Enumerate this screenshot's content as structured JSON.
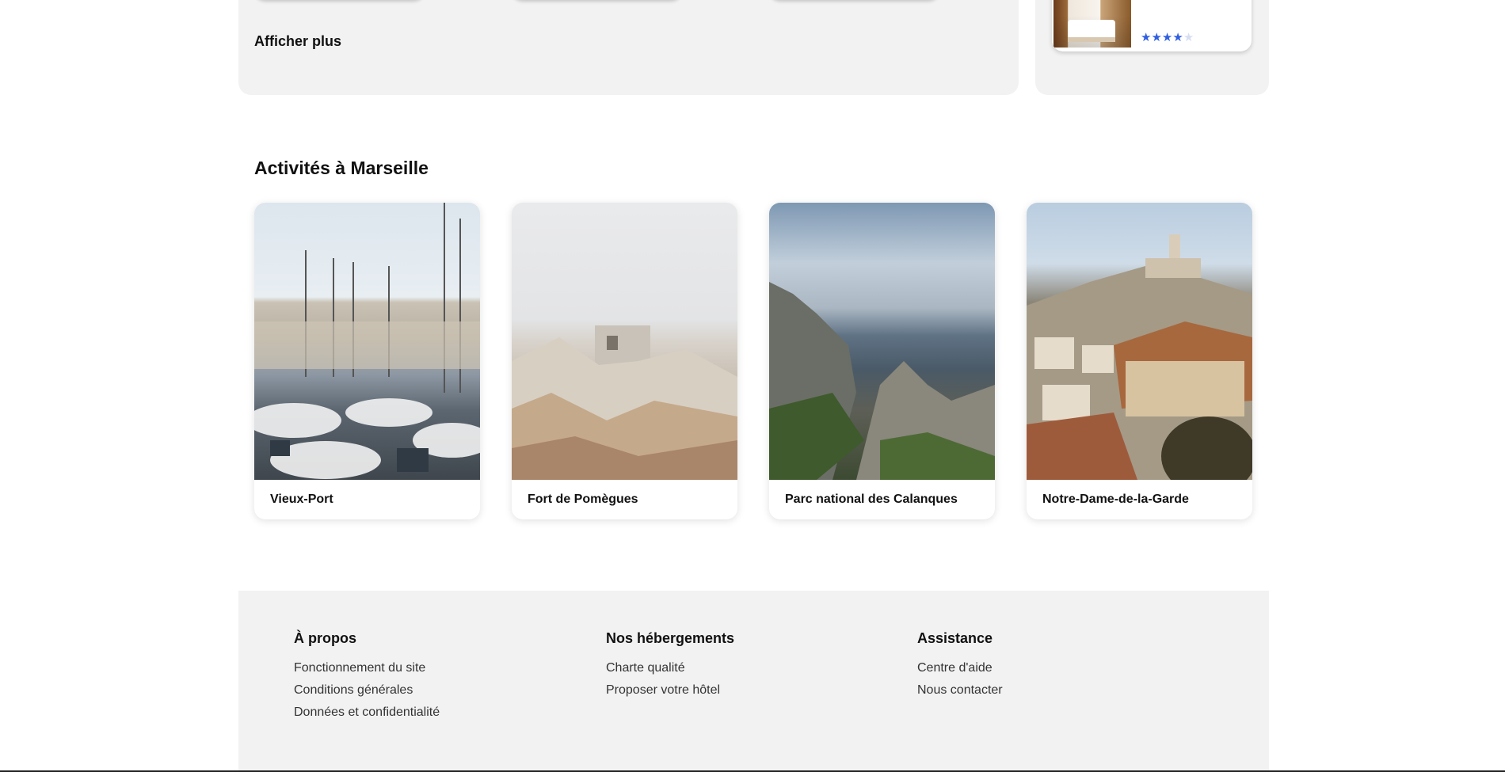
{
  "top_section": {
    "show_more_label": "Afficher plus",
    "hotel_card": {
      "stars_filled": 4,
      "stars_total": 5,
      "star_color": "#2f5ee0"
    }
  },
  "activities": {
    "title": "Activités à Marseille",
    "items": [
      {
        "label": "Vieux-Port"
      },
      {
        "label": "Fort de Pomègues"
      },
      {
        "label": "Parc national des Calanques"
      },
      {
        "label": "Notre-Dame-de-la-Garde"
      }
    ]
  },
  "footer": {
    "columns": [
      {
        "heading": "À propos",
        "links": [
          "Fonctionnement du site",
          "Conditions générales",
          "Données et confidentialité"
        ]
      },
      {
        "heading": "Nos hébergements",
        "links": [
          "Charte qualité",
          "Proposer votre hôtel"
        ]
      },
      {
        "heading": "Assistance",
        "links": [
          "Centre d'aide",
          "Nous contacter"
        ]
      }
    ]
  },
  "colors": {
    "panel_bg": "#f2f2f2",
    "accent_blue": "#2f5ee0"
  }
}
